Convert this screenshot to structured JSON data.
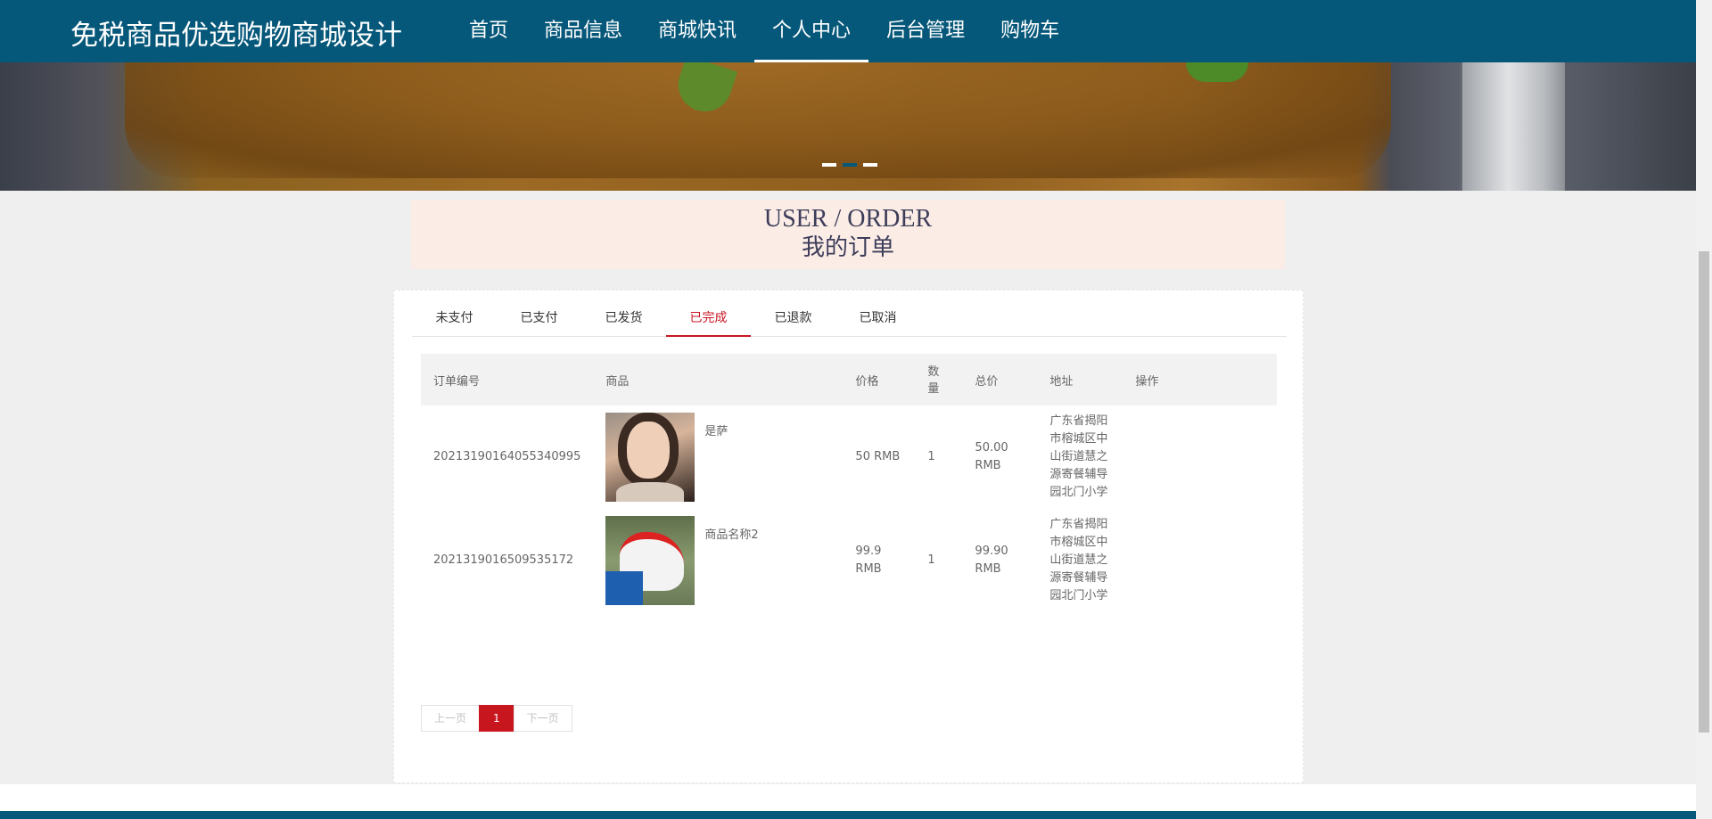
{
  "header": {
    "brand": "免税商品优选购物商城设计",
    "nav": [
      "首页",
      "商品信息",
      "商城快讯",
      "个人中心",
      "后台管理",
      "购物车"
    ],
    "active_nav": "个人中心"
  },
  "banner": {
    "slide_count": 3,
    "active_slide": 2
  },
  "section_title": {
    "en": "USER / ORDER",
    "cn": "我的订单"
  },
  "tabs": [
    "未支付",
    "已支付",
    "已发货",
    "已完成",
    "已退款",
    "已取消"
  ],
  "active_tab": "已完成",
  "table": {
    "headers": {
      "order_no": "订单编号",
      "product": "商品",
      "price": "价格",
      "qty": "数量",
      "total": "总价",
      "address": "地址",
      "action": "操作"
    },
    "rows": [
      {
        "order_no": "20213190164055340995",
        "product_name": "是萨",
        "thumb_icon": "portrait-photo",
        "price": "50 RMB",
        "qty": "1",
        "total": "50.00 RMB",
        "address": "广东省揭阳市榕城区中山街道慧之源寄餐辅导园北门小学"
      },
      {
        "order_no": "2021319016509535172",
        "product_name": "商品名称2",
        "thumb_icon": "sneaker-photo",
        "price": "99.9 RMB",
        "qty": "1",
        "total": "99.90 RMB",
        "address": "广东省揭阳市榕城区中山街道慧之源寄餐辅导园北门小学"
      }
    ]
  },
  "pagination": {
    "prev": "上一页",
    "current": "1",
    "next": "下一页"
  },
  "colors": {
    "primary": "#06587a",
    "accent_red": "#c8161e",
    "title_bg": "#fbece6"
  }
}
